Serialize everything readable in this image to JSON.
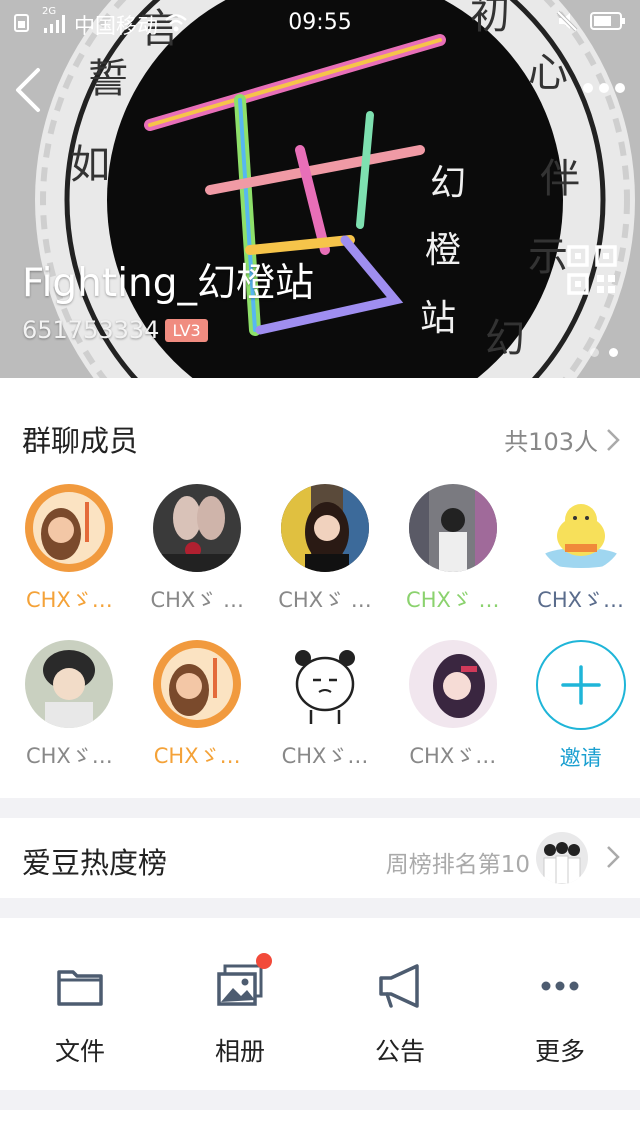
{
  "status_bar": {
    "network_label": "2G",
    "carrier": "中国移动",
    "time": "09:55"
  },
  "group": {
    "name": "Fighting_幻橙站",
    "id": "651753334",
    "level": "LV3",
    "banner_text": [
      "如",
      "誓",
      "言",
      "初",
      "心",
      "伴",
      "示",
      "幻",
      "橙",
      "站"
    ]
  },
  "members": {
    "title": "群聊成员",
    "count_label": "共103人",
    "list": [
      {
        "name": "CHXゞ…",
        "color": "#f4a238"
      },
      {
        "name": "CHXゞ …",
        "color": "#888888"
      },
      {
        "name": "CHXゞ …",
        "color": "#888888"
      },
      {
        "name": "CHXゞ …",
        "color": "#8bd26e"
      },
      {
        "name": "CHXゞ…",
        "color": "#5a6c8c"
      },
      {
        "name": "CHXゞ…",
        "color": "#888888"
      },
      {
        "name": "CHXゞ…",
        "color": "#f4a238"
      },
      {
        "name": "CHXゞ…",
        "color": "#888888"
      },
      {
        "name": "CHXゞ…",
        "color": "#888888"
      }
    ],
    "invite_label": "邀请"
  },
  "ranking": {
    "title": "爱豆热度榜",
    "text": "周榜排名第10"
  },
  "actions": [
    {
      "label": "文件",
      "icon": "folder-icon"
    },
    {
      "label": "相册",
      "icon": "photo-album-icon"
    },
    {
      "label": "公告",
      "icon": "megaphone-icon"
    },
    {
      "label": "更多",
      "icon": "more-dots-icon"
    }
  ],
  "colors": {
    "accent": "#1fb5d8",
    "orange_name": "#f4a238",
    "green_name": "#8bd26e",
    "badge": "#f08c80",
    "notification": "#f24a3a"
  }
}
